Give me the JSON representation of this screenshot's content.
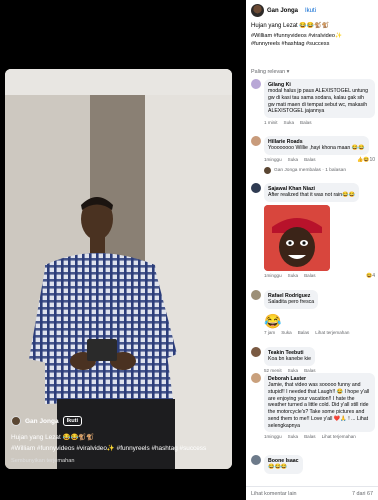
{
  "video": {
    "author": "Gan Jonga",
    "follow_label": "Ikuti",
    "caption": "Hujan yang Lezat 😂😂🐒🐒",
    "hashtags": "#William #funnyvideos #viralvideo✨ #funnyreels #hashtag #success",
    "hide_translation": "Sembunyikan terjemahan"
  },
  "post": {
    "author": "Gan Jonga",
    "follow_label": "Ikuti",
    "caption": "Hujan yang Lezat 😂😂🐒🐒",
    "hashtags_line1": "#William #funnyvideos #viralvideo✨",
    "hashtags_line2": "#funnyreels #hashtag #success"
  },
  "comments_sort_label": "Paling relevan ▾",
  "comments": [
    {
      "name": "Gilang Ki",
      "text": "modal halus jp paus ALEXISTOGEL untung gw di kasi tau sama sodara, kalau gak sih gw mati maen di tempat sebut wc, makasih ALEXISTOGEL jajannya",
      "time": "1 minit",
      "like": "Suka",
      "reply": "Balas"
    },
    {
      "name": "Hillarie Roads",
      "text": "Yoooooooo Willie ,hayi khona maan 😂😂",
      "time": "1minggu",
      "like": "Suka",
      "reply": "Balas",
      "reaction_count": "10",
      "reply_summary": "Gan Jonga membalas · 1 balasan"
    },
    {
      "name": "Sajawal Khan Niazi",
      "text": "After realized that it was not rain😂😂",
      "time": "1minggu",
      "like": "Suka",
      "reply": "Balas",
      "reaction_count": "4"
    },
    {
      "name": "Rafael Rodriguez",
      "text": "Saladita pero fresca",
      "time": "",
      "like": "",
      "reply": ""
    },
    {
      "emoji": "😂",
      "time": "7 jam",
      "like": "Suka",
      "reply": "Balas",
      "extra": "Lihat terjemahan"
    },
    {
      "name": "Teakin Teebuti",
      "text": "Koa bn kanebe kie",
      "time": "52 menit",
      "like": "Suka",
      "reply": "Balas"
    },
    {
      "name": "Deborah Laster",
      "text": "Jamie, that video was sooooo funny and stupid!! I needed that Laugh!! 😂 I hope y'all are enjoying your vacation!! I hate the weather turned a little cold. Did y'all still ride the motorcycle's? Take some pictures and send them to me!! Love y'all ❤️🙏 ! ... Lihat selengkapnya",
      "time": "1minggu",
      "like": "Suka",
      "reply": "Balas",
      "extra": "Lihat terjemahan"
    },
    {
      "name": "Boone Isaac",
      "text": "😂😂😂",
      "time": "",
      "like": "",
      "reply": ""
    }
  ],
  "footer": {
    "more_comments": "Lihat komentar lain",
    "count": "7 dari 67"
  }
}
